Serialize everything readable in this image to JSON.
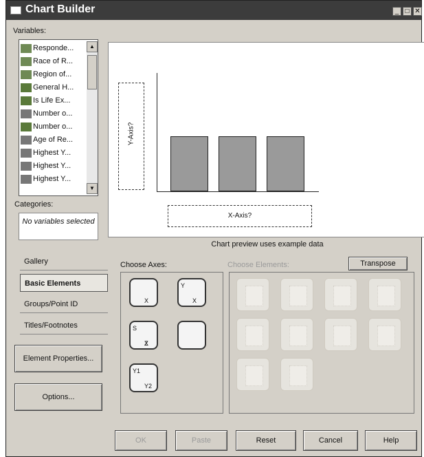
{
  "window": {
    "title": "Chart Builder"
  },
  "variables": {
    "label": "Variables:",
    "items": [
      {
        "label": "Responde...",
        "icon": "nominal-icon"
      },
      {
        "label": "Race of R...",
        "icon": "nominal-icon"
      },
      {
        "label": "Region of...",
        "icon": "nominal-icon"
      },
      {
        "label": "General H...",
        "icon": "ordinal-icon"
      },
      {
        "label": "Is Life Ex...",
        "icon": "ordinal-icon"
      },
      {
        "label": "Number o...",
        "icon": "scale-icon"
      },
      {
        "label": "Number o...",
        "icon": "ordinal-icon"
      },
      {
        "label": "Age of Re...",
        "icon": "scale-icon"
      },
      {
        "label": "Highest Y...",
        "icon": "scale-icon"
      },
      {
        "label": "Highest Y...",
        "icon": "scale-icon"
      },
      {
        "label": "Highest Y...",
        "icon": "scale-icon"
      }
    ]
  },
  "categories": {
    "label": "Categories:",
    "empty_text": "No variables selected"
  },
  "preview": {
    "y_axis_label": "Y-Axis?",
    "x_axis_label": "X-Axis?",
    "note": "Chart preview uses example data"
  },
  "nav": [
    {
      "label": "Gallery",
      "active": false
    },
    {
      "label": "Basic Elements",
      "active": true
    },
    {
      "label": "Groups/Point ID",
      "active": false
    },
    {
      "label": "Titles/Footnotes",
      "active": false
    }
  ],
  "side_buttons": {
    "element_properties": "Element Properties...",
    "options": "Options..."
  },
  "choose_axes": {
    "label": "Choose Axes:",
    "buttons": [
      {
        "name": "1d-x-axis",
        "labels": [
          "X"
        ]
      },
      {
        "name": "2d-xy-axis",
        "labels": [
          "Y",
          "X"
        ]
      },
      {
        "name": "3d-axis",
        "labels": [
          "S",
          "X",
          "Z"
        ]
      },
      {
        "name": "polar-axis",
        "labels": []
      },
      {
        "name": "dual-y-axis",
        "labels": [
          "Y1",
          "Y2"
        ]
      }
    ]
  },
  "choose_elements": {
    "label": "Choose Elements:",
    "transpose": "Transpose",
    "count": 10
  },
  "bottom_buttons": {
    "ok": "OK",
    "paste": "Paste",
    "reset": "Reset",
    "cancel": "Cancel",
    "help": "Help"
  }
}
